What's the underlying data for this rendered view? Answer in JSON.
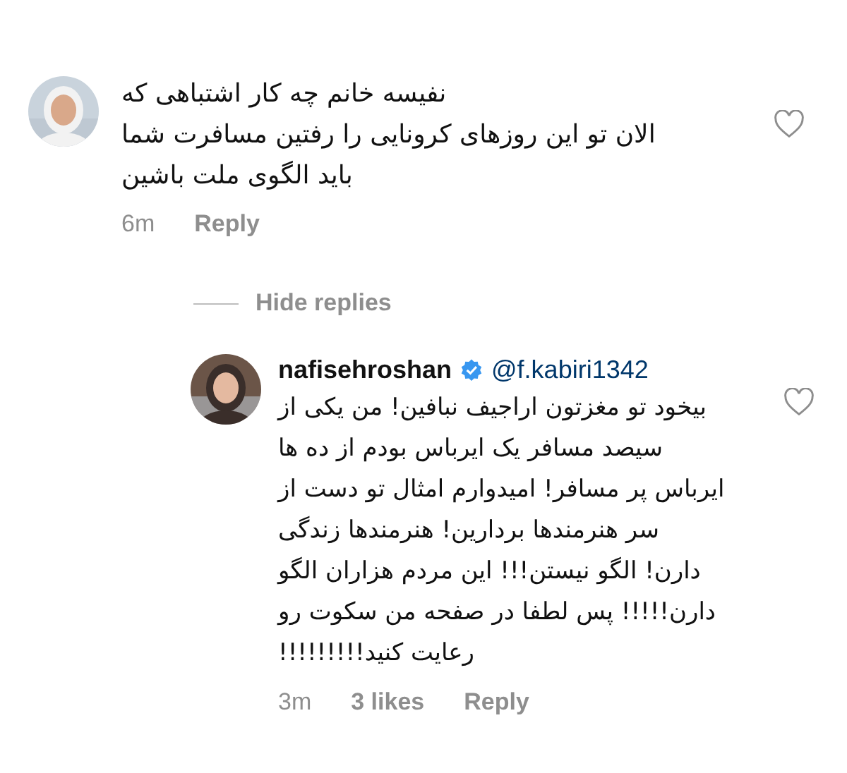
{
  "comment": {
    "lines": [
      "نفیسه خانم چه کار اشتباهی که",
      "الان تو این روزهای کرونایی را رفتین مسافرت شما",
      "باید الگوی ملت باشین"
    ],
    "time": "6m",
    "reply": "Reply"
  },
  "hide_replies": "Hide replies",
  "replies": [
    {
      "username": "nafisehroshan",
      "verified": true,
      "mention": "@f.kabiri1342",
      "lines": [
        "بیخود تو مغزتون اراجیف نبافین! من یکی از",
        "سیصد مسافر یک ایرباس بودم از ده ها",
        "ایرباس پر مسافر! امیدوارم امثال تو دست از",
        "سر هنرمندها بردارین! هنرمندها زندگی",
        "دارن! الگو نیستن!!! این مردم هزاران الگو",
        "دارن!!!!! پس لطفا در صفحه من سکوت رو",
        "رعایت کنید!!!!!!!!!"
      ],
      "time": "3m",
      "likes": "3 likes",
      "reply": "Reply"
    }
  ]
}
